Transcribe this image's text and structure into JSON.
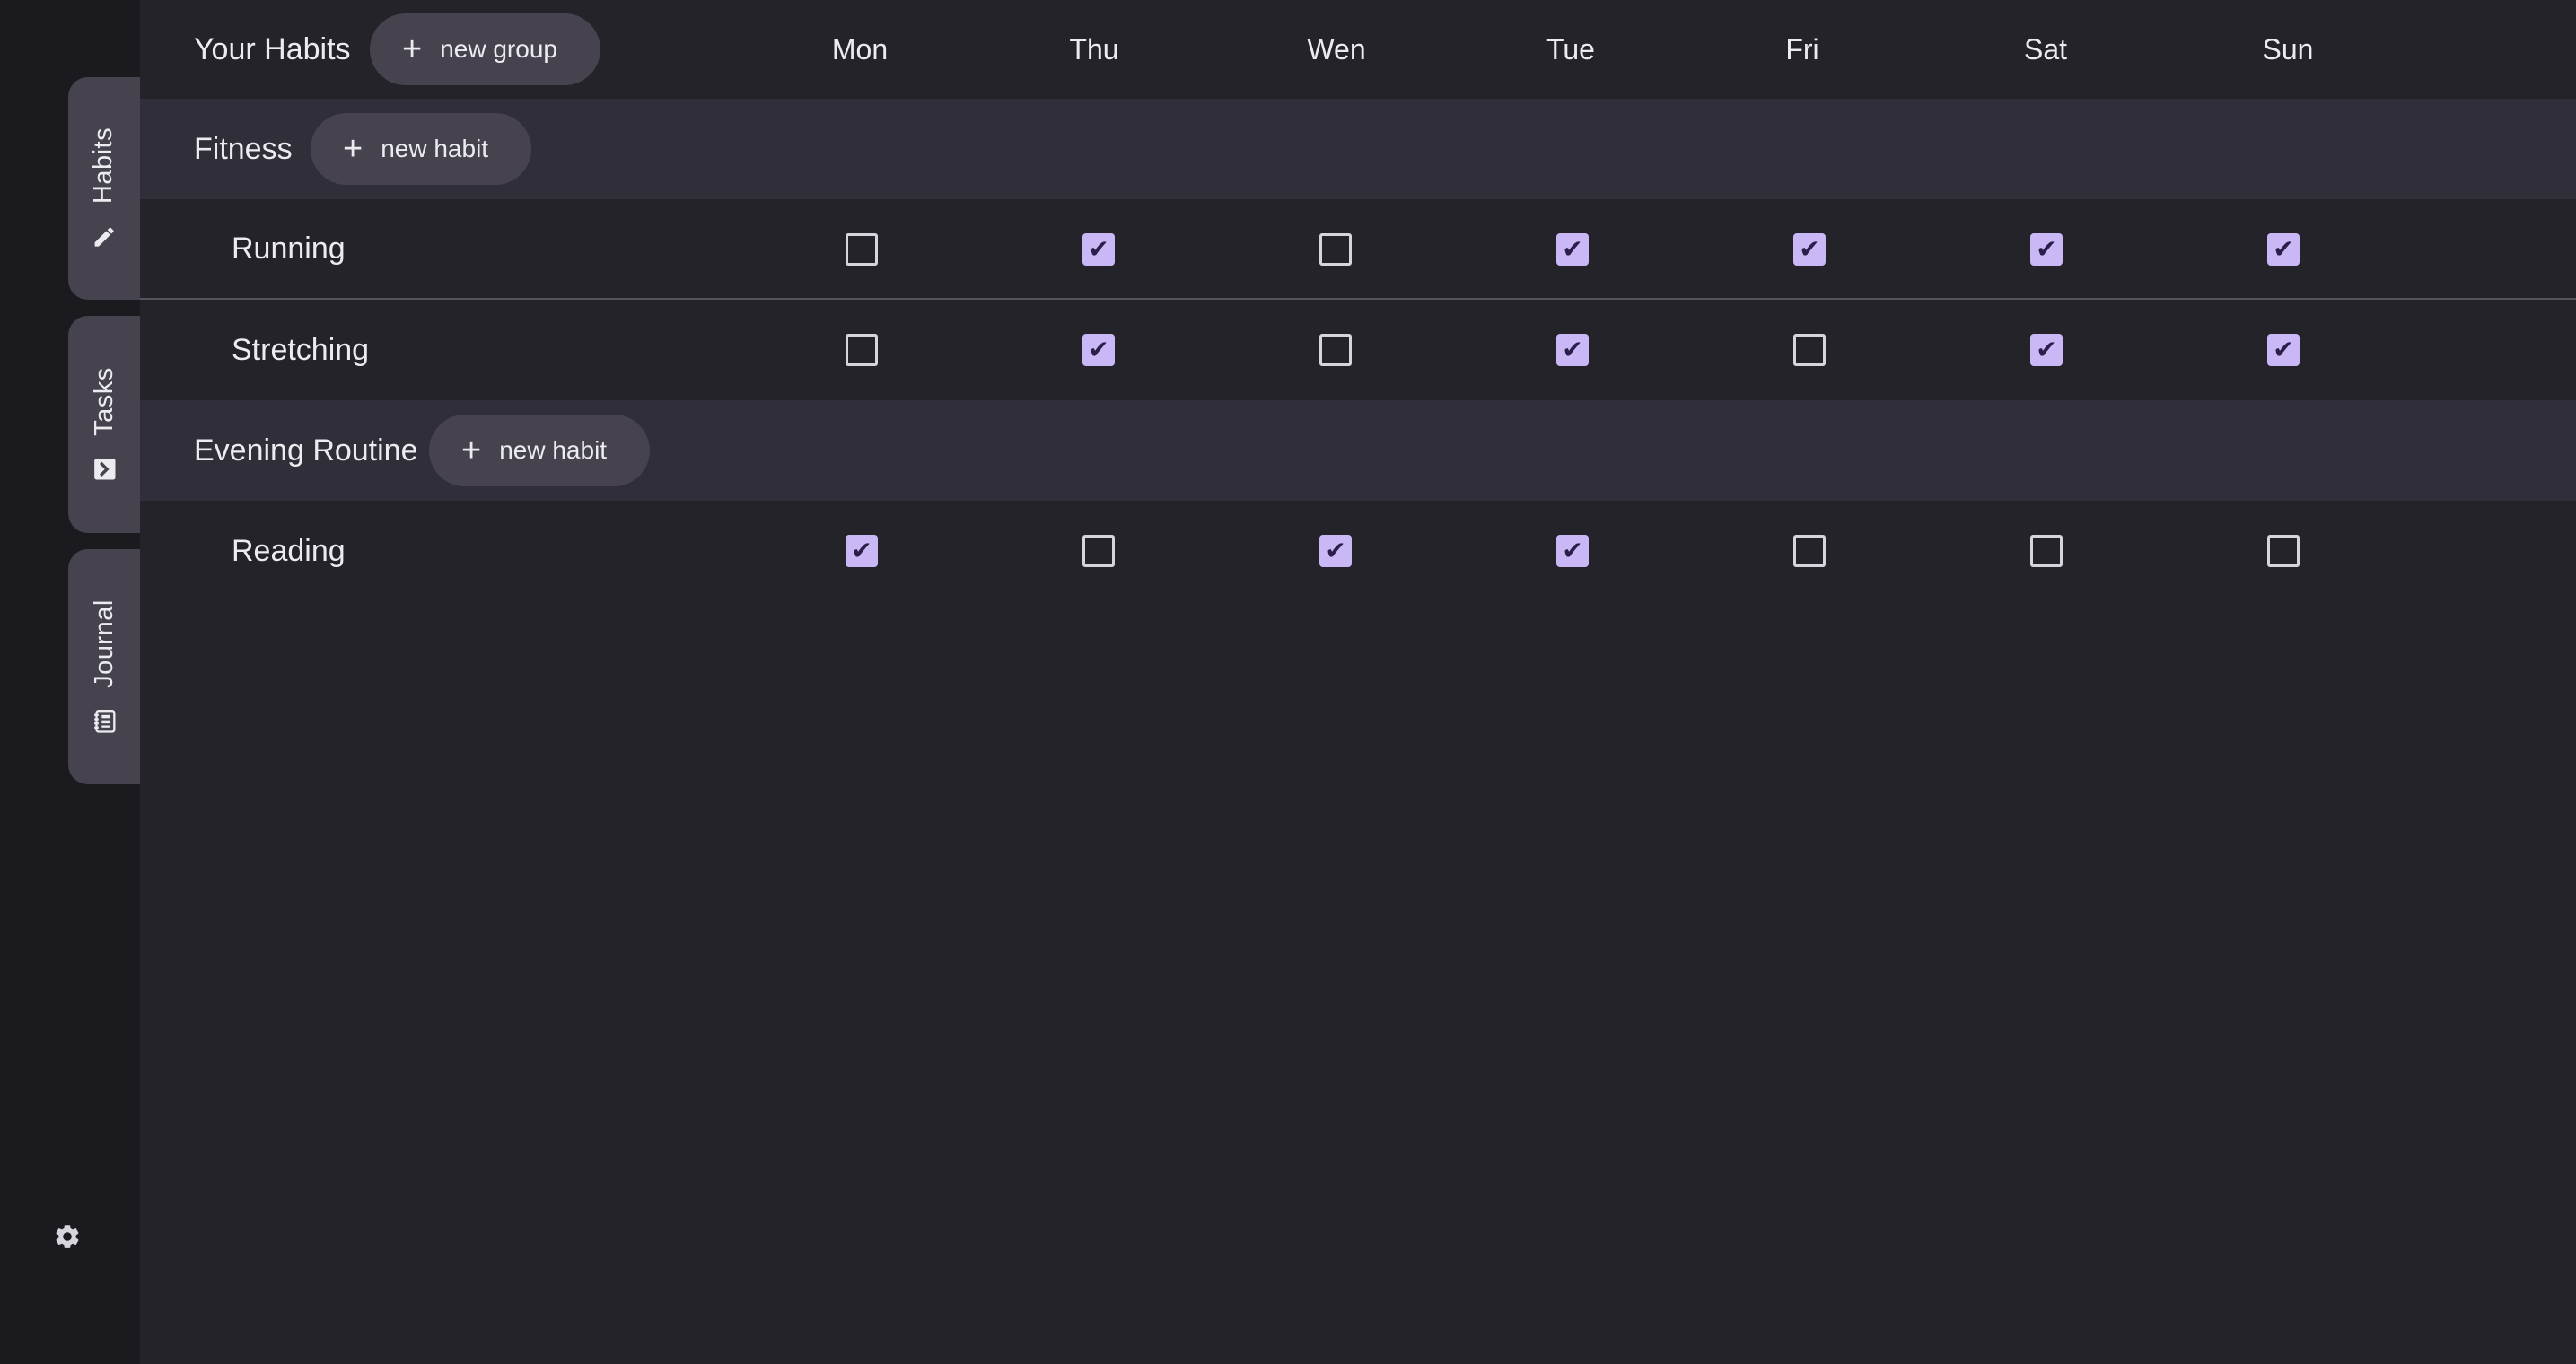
{
  "sidebar": {
    "tabs": [
      {
        "label": "Habits",
        "icon": "pencil-icon"
      },
      {
        "label": "Tasks",
        "icon": "task-icon"
      },
      {
        "label": "Journal",
        "icon": "notebook-icon"
      }
    ],
    "settings_icon": "gear-icon"
  },
  "header": {
    "title": "Your Habits",
    "new_group_label": "new group",
    "days": [
      "Mon",
      "Thu",
      "Wen",
      "Tue",
      "Fri",
      "Sat",
      "Sun"
    ]
  },
  "groups": [
    {
      "name": "Fitness",
      "new_habit_label": "new habit",
      "habits": [
        {
          "name": "Running",
          "checks": [
            false,
            true,
            false,
            true,
            true,
            true,
            true
          ]
        },
        {
          "name": "Stretching",
          "checks": [
            false,
            true,
            false,
            true,
            false,
            true,
            true
          ]
        }
      ]
    },
    {
      "name": "Evening Routine",
      "new_habit_label": "new habit",
      "habits": [
        {
          "name": "Reading",
          "checks": [
            true,
            false,
            true,
            true,
            false,
            false,
            false
          ]
        }
      ]
    }
  ],
  "colors": {
    "background": "#242329",
    "sidebar": "#1b1a1f",
    "group_row": "#302e38",
    "pill": "#46434f",
    "checked": "#c9b8f5"
  }
}
